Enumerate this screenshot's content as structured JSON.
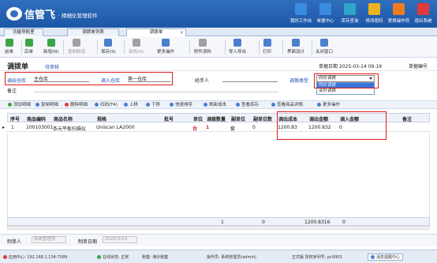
{
  "app": {
    "title": "信管飞",
    "subtitle": "· 精细化管理软件"
  },
  "top_nav": [
    {
      "label": "我的工作台",
      "icon": "monitor-icon",
      "color": "#3b8be0"
    },
    {
      "label": "单据中心",
      "icon": "document-icon",
      "color": "#3b8be0"
    },
    {
      "label": "库存查询",
      "icon": "warehouse-icon",
      "color": "#2fa6c8"
    },
    {
      "label": "修改密码",
      "icon": "lock-icon",
      "color": "#f0b320"
    },
    {
      "label": "更换操作员",
      "icon": "user-icon",
      "color": "#f07a20"
    },
    {
      "label": "退出系统",
      "icon": "exit-icon",
      "color": "#e03a3a"
    }
  ],
  "tabs": [
    {
      "label": "功能导航室",
      "active": false
    },
    {
      "label": "调拨单列表",
      "active": false
    },
    {
      "label": "调拨单",
      "active": true
    }
  ],
  "toolbar": [
    {
      "label": "前单",
      "icon": "prev-icon",
      "color": "#3aa545",
      "disabled": false
    },
    {
      "label": "后单",
      "icon": "next-icon",
      "color": "#3aa545",
      "disabled": false
    },
    {
      "label": "新增(N)",
      "icon": "add-icon",
      "color": "#3aa545",
      "disabled": false
    },
    {
      "label": "复制新增",
      "icon": "copy-icon",
      "color": "#a0a0a0",
      "disabled": true
    },
    {
      "label": "保存(S)",
      "icon": "save-icon",
      "color": "#4a7fd0",
      "disabled": false
    },
    {
      "label": "审核(A)",
      "icon": "audit-icon",
      "color": "#a0a0a0",
      "disabled": true
    },
    {
      "label": "更多操作",
      "icon": "more-icon",
      "color": "#4a7fd0",
      "disabled": false
    },
    {
      "label": "附件资料",
      "icon": "attachment-icon",
      "color": "#a0a0a0",
      "disabled": false
    },
    {
      "label": "导入导出",
      "icon": "import-export-icon",
      "color": "#4a7fd0",
      "disabled": false
    },
    {
      "label": "打印",
      "icon": "print-icon",
      "color": "#4a7fd0",
      "disabled": false
    },
    {
      "label": "界面设计",
      "icon": "design-icon",
      "color": "#4a7fd0",
      "disabled": false
    },
    {
      "label": "关闭窗口",
      "icon": "close-window-icon",
      "color": "#4a7fd0",
      "disabled": false
    }
  ],
  "doc": {
    "title": "调拨单",
    "status": "待审核",
    "date_label": "单据日期",
    "date_value": "2025-03-14 09:19",
    "no_label": "单据编号"
  },
  "form": {
    "out_wh_label": "调出仓库",
    "out_wh_value": "主仓库",
    "in_wh_label": "调入仓库",
    "in_wh_value": "第一仓库",
    "handler_label": "经手人",
    "handler_value": "",
    "transfer_type_label": "调拨类型",
    "transfer_type_value": "同价调拨",
    "transfer_type_options": [
      "同价调拨",
      "变价调拨"
    ],
    "remark_label": "备注",
    "remark_value": ""
  },
  "grid_toolbar": [
    {
      "label": "添加明细",
      "icon": "add-row-icon",
      "color": "#3aa545"
    },
    {
      "label": "复制明细",
      "icon": "copy-row-icon",
      "color": "#4a7fd0"
    },
    {
      "label": "删除明细",
      "icon": "delete-row-icon",
      "color": "#e03a3a"
    },
    {
      "label": "扫码(F4)",
      "icon": "scan-icon",
      "color": "#4a7fd0"
    },
    {
      "label": "上移",
      "icon": "up-icon",
      "color": "#4a7fd0"
    },
    {
      "label": "下移",
      "icon": "down-icon",
      "color": "#4a7fd0"
    },
    {
      "label": "快速排序",
      "icon": "sort-icon",
      "color": "#4a7fd0"
    },
    {
      "label": "刷新成本",
      "icon": "refresh-icon",
      "color": "#4a7fd0"
    },
    {
      "label": "查看库存",
      "icon": "view-stock-icon",
      "color": "#4a7fd0"
    },
    {
      "label": "查看商品详情",
      "icon": "view-detail-icon",
      "color": "#4a7fd0"
    },
    {
      "label": "更多操作",
      "icon": "more-icon",
      "color": "#4a7fd0"
    }
  ],
  "table": {
    "headers": [
      "序号",
      "商品编码",
      "商品名称",
      "规格",
      "批号",
      "单位",
      "调拨数量",
      "副单位",
      "副单位数",
      "调出成本",
      "调出金额",
      "调入金额",
      "备注"
    ],
    "rows": [
      {
        "no": "1",
        "code": "100103001",
        "name": "条元平板扫描仪",
        "spec": "Uniscan LA2000",
        "batch": "",
        "unit": "台",
        "qty": "1",
        "sub_unit": "套",
        "sub_qty": "0",
        "out_cost": "1200.83",
        "out_amount": "1200.832",
        "in_amount": "0",
        "remark": ""
      }
    ],
    "totals": {
      "qty": "1",
      "sub_qty": "0",
      "out_amount": "1200.8316",
      "in_amount": "0"
    }
  },
  "footer": {
    "maker_label": "制单人",
    "maker_value": "系统管理员",
    "make_date_label": "制单日期",
    "make_date_value": "2025/3/14"
  },
  "status_bar": {
    "app_center": "应用中心: 192.168.1.134:7099",
    "connection": "在线状态: 正常",
    "account": "账套: 演示账套",
    "operator": "操作员: 系统管理员(admin)",
    "edition": "正式版 授权序列号: pc0003",
    "message": "消息提醒中心"
  }
}
